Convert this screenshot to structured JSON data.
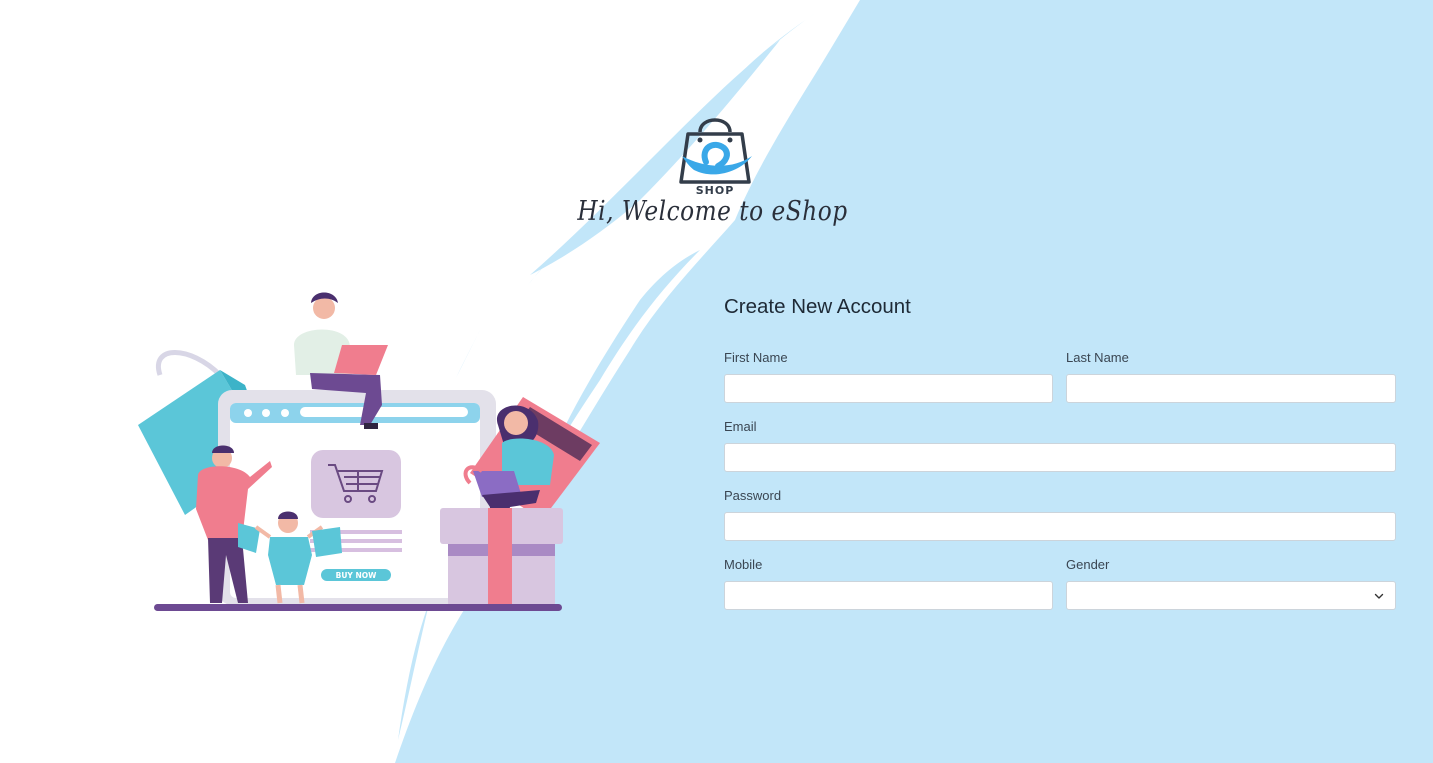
{
  "brand": {
    "logo_text": "SHOP",
    "welcome": "Hi, Welcome to eShop"
  },
  "illustration": {
    "buy_now_label": "BUY NOW"
  },
  "form": {
    "title": "Create New Account",
    "first_name": {
      "label": "First Name",
      "value": "",
      "placeholder": ""
    },
    "last_name": {
      "label": "Last Name",
      "value": "",
      "placeholder": ""
    },
    "email": {
      "label": "Email",
      "value": "",
      "placeholder": ""
    },
    "password": {
      "label": "Password",
      "value": "",
      "placeholder": ""
    },
    "mobile": {
      "label": "Mobile",
      "value": "",
      "placeholder": ""
    },
    "gender": {
      "label": "Gender",
      "selected": ""
    }
  },
  "colors": {
    "accent_blue": "#c2e6f9",
    "logo_blue": "#3aa8e8",
    "text_dark": "#1e2a36"
  },
  "icons": {
    "bag": "shopping-bag-icon",
    "dropdown": "chevron-down-icon",
    "cart": "cart-icon"
  }
}
